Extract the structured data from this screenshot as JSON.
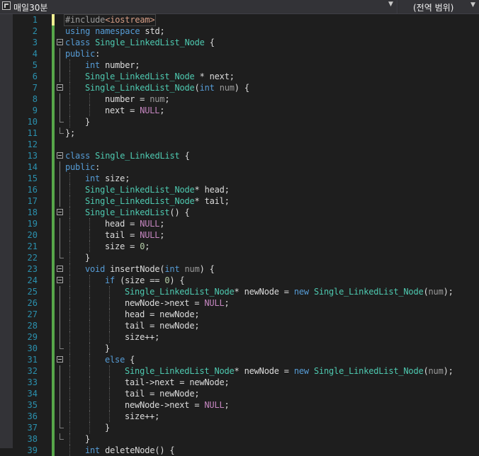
{
  "toolbar": {
    "project_name": "매일30분",
    "scope_label": "(전역 범위)"
  },
  "colors": {
    "keyword": "#569cd6",
    "type": "#4ec9b0",
    "macro": "#c586c0",
    "number": "#b5cea8",
    "parameter": "#9a9a9a",
    "line_number": "#2b91af",
    "change_saved": "#57a64a",
    "change_unsaved": "#efef91"
  },
  "code_lines": [
    {
      "n": "1",
      "indent": 0,
      "tokens": [
        [
          "pp",
          "#include"
        ],
        [
          "hdr",
          "<iostream>"
        ]
      ]
    },
    {
      "n": "2",
      "indent": 0,
      "tokens": [
        [
          "kw",
          "using"
        ],
        [
          "plain",
          " "
        ],
        [
          "kw",
          "namespace"
        ],
        [
          "plain",
          " std;"
        ]
      ]
    },
    {
      "n": "3",
      "indent": 0,
      "tokens": [
        [
          "kw",
          "class"
        ],
        [
          "plain",
          " "
        ],
        [
          "ty",
          "Single_LinkedList_Node"
        ],
        [
          "plain",
          " {"
        ]
      ]
    },
    {
      "n": "4",
      "indent": 0,
      "tokens": [
        [
          "kw",
          "public"
        ],
        [
          "plain",
          ":"
        ]
      ]
    },
    {
      "n": "5",
      "indent": 1,
      "tokens": [
        [
          "kw",
          "int"
        ],
        [
          "plain",
          " number;"
        ]
      ]
    },
    {
      "n": "6",
      "indent": 1,
      "tokens": [
        [
          "ty",
          "Single_LinkedList_Node"
        ],
        [
          "plain",
          " * next;"
        ]
      ]
    },
    {
      "n": "7",
      "indent": 1,
      "tokens": [
        [
          "ty",
          "Single_LinkedList_Node"
        ],
        [
          "plain",
          "("
        ],
        [
          "kw",
          "int"
        ],
        [
          "plain",
          " "
        ],
        [
          "param",
          "num"
        ],
        [
          "plain",
          ") {"
        ]
      ]
    },
    {
      "n": "8",
      "indent": 2,
      "tokens": [
        [
          "plain",
          "number = "
        ],
        [
          "param",
          "num"
        ],
        [
          "plain",
          ";"
        ]
      ]
    },
    {
      "n": "9",
      "indent": 2,
      "tokens": [
        [
          "plain",
          "next = "
        ],
        [
          "mac",
          "NULL"
        ],
        [
          "plain",
          ";"
        ]
      ]
    },
    {
      "n": "10",
      "indent": 1,
      "tokens": [
        [
          "plain",
          "}"
        ]
      ]
    },
    {
      "n": "11",
      "indent": 0,
      "tokens": [
        [
          "plain",
          "};"
        ]
      ]
    },
    {
      "n": "12",
      "indent": 0,
      "tokens": []
    },
    {
      "n": "13",
      "indent": 0,
      "tokens": [
        [
          "kw",
          "class"
        ],
        [
          "plain",
          " "
        ],
        [
          "ty",
          "Single_LinkedList"
        ],
        [
          "plain",
          " {"
        ]
      ]
    },
    {
      "n": "14",
      "indent": 0,
      "tokens": [
        [
          "kw",
          "public"
        ],
        [
          "plain",
          ":"
        ]
      ]
    },
    {
      "n": "15",
      "indent": 1,
      "tokens": [
        [
          "kw",
          "int"
        ],
        [
          "plain",
          " size;"
        ]
      ]
    },
    {
      "n": "16",
      "indent": 1,
      "tokens": [
        [
          "ty",
          "Single_LinkedList_Node"
        ],
        [
          "plain",
          "* head;"
        ]
      ]
    },
    {
      "n": "17",
      "indent": 1,
      "tokens": [
        [
          "ty",
          "Single_LinkedList_Node"
        ],
        [
          "plain",
          "* tail;"
        ]
      ]
    },
    {
      "n": "18",
      "indent": 1,
      "tokens": [
        [
          "ty",
          "Single_LinkedList"
        ],
        [
          "plain",
          "() {"
        ]
      ]
    },
    {
      "n": "19",
      "indent": 2,
      "tokens": [
        [
          "plain",
          "head = "
        ],
        [
          "mac",
          "NULL"
        ],
        [
          "plain",
          ";"
        ]
      ]
    },
    {
      "n": "20",
      "indent": 2,
      "tokens": [
        [
          "plain",
          "tail = "
        ],
        [
          "mac",
          "NULL"
        ],
        [
          "plain",
          ";"
        ]
      ]
    },
    {
      "n": "21",
      "indent": 2,
      "tokens": [
        [
          "plain",
          "size = "
        ],
        [
          "num",
          "0"
        ],
        [
          "plain",
          ";"
        ]
      ]
    },
    {
      "n": "22",
      "indent": 1,
      "tokens": [
        [
          "plain",
          "}"
        ]
      ]
    },
    {
      "n": "23",
      "indent": 1,
      "tokens": [
        [
          "kw",
          "void"
        ],
        [
          "plain",
          " insertNode("
        ],
        [
          "kw",
          "int"
        ],
        [
          "plain",
          " "
        ],
        [
          "param",
          "num"
        ],
        [
          "plain",
          ") {"
        ]
      ]
    },
    {
      "n": "24",
      "indent": 2,
      "tokens": [
        [
          "kw",
          "if"
        ],
        [
          "plain",
          " (size == "
        ],
        [
          "num",
          "0"
        ],
        [
          "plain",
          ") {"
        ]
      ]
    },
    {
      "n": "25",
      "indent": 3,
      "tokens": [
        [
          "ty",
          "Single_LinkedList_Node"
        ],
        [
          "plain",
          "* newNode = "
        ],
        [
          "kw",
          "new"
        ],
        [
          "plain",
          " "
        ],
        [
          "ty",
          "Single_LinkedList_Node"
        ],
        [
          "plain",
          "("
        ],
        [
          "param",
          "num"
        ],
        [
          "plain",
          ");"
        ]
      ]
    },
    {
      "n": "26",
      "indent": 3,
      "tokens": [
        [
          "plain",
          "newNode->next = "
        ],
        [
          "mac",
          "NULL"
        ],
        [
          "plain",
          ";"
        ]
      ]
    },
    {
      "n": "27",
      "indent": 3,
      "tokens": [
        [
          "plain",
          "head = newNode;"
        ]
      ]
    },
    {
      "n": "28",
      "indent": 3,
      "tokens": [
        [
          "plain",
          "tail = newNode;"
        ]
      ]
    },
    {
      "n": "29",
      "indent": 3,
      "tokens": [
        [
          "plain",
          "size++;"
        ]
      ]
    },
    {
      "n": "30",
      "indent": 2,
      "tokens": [
        [
          "plain",
          "}"
        ]
      ]
    },
    {
      "n": "31",
      "indent": 2,
      "tokens": [
        [
          "kw",
          "else"
        ],
        [
          "plain",
          " {"
        ]
      ]
    },
    {
      "n": "32",
      "indent": 3,
      "tokens": [
        [
          "ty",
          "Single_LinkedList_Node"
        ],
        [
          "plain",
          "* newNode = "
        ],
        [
          "kw",
          "new"
        ],
        [
          "plain",
          " "
        ],
        [
          "ty",
          "Single_LinkedList_Node"
        ],
        [
          "plain",
          "("
        ],
        [
          "param",
          "num"
        ],
        [
          "plain",
          ");"
        ]
      ]
    },
    {
      "n": "33",
      "indent": 3,
      "tokens": [
        [
          "plain",
          "tail->next = newNode;"
        ]
      ]
    },
    {
      "n": "34",
      "indent": 3,
      "tokens": [
        [
          "plain",
          "tail = newNode;"
        ]
      ]
    },
    {
      "n": "35",
      "indent": 3,
      "tokens": [
        [
          "plain",
          "newNode->next = "
        ],
        [
          "mac",
          "NULL"
        ],
        [
          "plain",
          ";"
        ]
      ]
    },
    {
      "n": "36",
      "indent": 3,
      "tokens": [
        [
          "plain",
          "size++;"
        ]
      ]
    },
    {
      "n": "37",
      "indent": 2,
      "tokens": [
        [
          "plain",
          "}"
        ]
      ]
    },
    {
      "n": "38",
      "indent": 1,
      "tokens": [
        [
          "plain",
          "}"
        ]
      ]
    },
    {
      "n": "39",
      "indent": 1,
      "tokens": [
        [
          "kw",
          "int"
        ],
        [
          "plain",
          " deleteNode() {"
        ]
      ]
    }
  ]
}
